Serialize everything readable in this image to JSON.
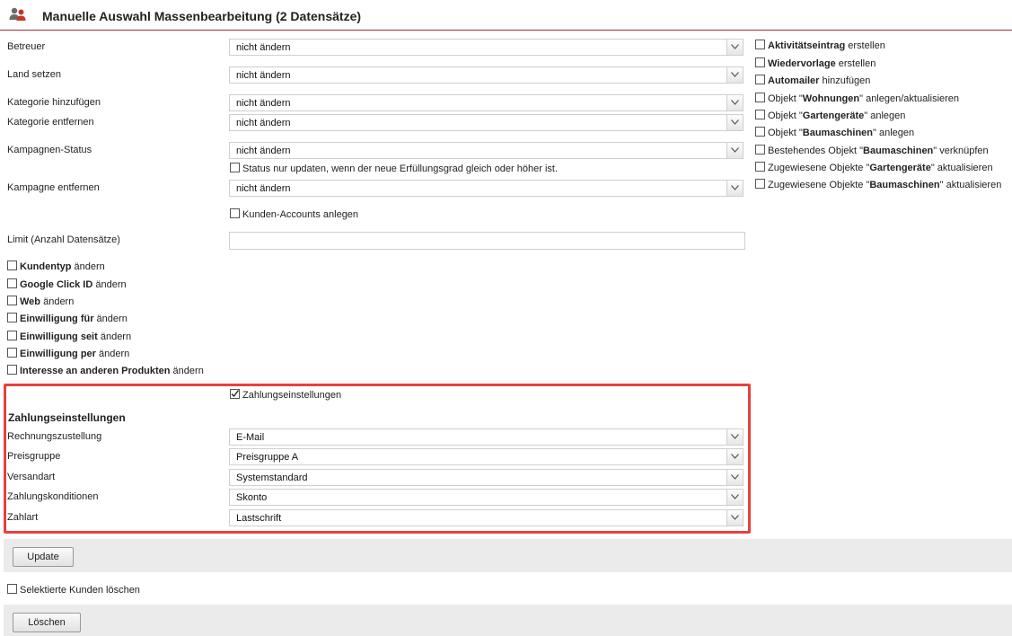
{
  "header": {
    "title": "Manuelle Auswahl Massenbearbeitung (2 Datensätze)"
  },
  "fields": {
    "betreuer": {
      "label": "Betreuer",
      "value": "nicht ändern"
    },
    "land": {
      "label": "Land setzen",
      "value": "nicht ändern"
    },
    "kat_add": {
      "label": "Kategorie hinzufügen",
      "value": "nicht ändern"
    },
    "kat_remove": {
      "label": "Kategorie entfernen",
      "value": "nicht ändern"
    },
    "kampagnen_status": {
      "label": "Kampagnen-Status",
      "value": "nicht ändern"
    },
    "status_update_note": "Status nur updaten, wenn der neue Erfüllungsgrad gleich oder höher ist.",
    "kampagne_remove": {
      "label": "Kampagne entfernen",
      "value": "nicht ändern"
    },
    "kunden_accounts": "Kunden-Accounts anlegen",
    "limit": {
      "label": "Limit (Anzahl Datensätze)",
      "value": ""
    }
  },
  "change_checkboxes": [
    {
      "bold": "Kundentyp",
      "rest": " ändern"
    },
    {
      "bold": "Google Click ID",
      "rest": " ändern"
    },
    {
      "bold": "Web",
      "rest": " ändern"
    },
    {
      "bold": "Einwilligung für",
      "rest": " ändern"
    },
    {
      "bold": "Einwilligung seit",
      "rest": " ändern"
    },
    {
      "bold": "Einwilligung per",
      "rest": " ändern"
    },
    {
      "bold": "Interesse an anderen Produkten",
      "rest": " ändern"
    }
  ],
  "right_checkboxes": [
    {
      "pre": "",
      "bold": "Aktivitätseintrag",
      "post": " erstellen"
    },
    {
      "pre": "",
      "bold": "Wiedervorlage",
      "post": " erstellen"
    },
    {
      "pre": "",
      "bold": "Automailer",
      "post": " hinzufügen"
    },
    {
      "pre": "Objekt \"",
      "bold": "Wohnungen",
      "post": "\" anlegen/aktualisieren"
    },
    {
      "pre": "Objekt \"",
      "bold": "Gartengeräte",
      "post": "\" anlegen"
    },
    {
      "pre": "Objekt \"",
      "bold": "Baumaschinen",
      "post": "\" anlegen"
    },
    {
      "pre": "Bestehendes Objekt \"",
      "bold": "Baumaschinen",
      "post": "\" verknüpfen"
    },
    {
      "pre": "Zugewiesene Objekte \"",
      "bold": "Gartengeräte",
      "post": "\" aktualisieren"
    },
    {
      "pre": "Zugewiesene Objekte \"",
      "bold": "Baumaschinen",
      "post": "\" aktualisieren"
    }
  ],
  "payment": {
    "checkbox_label": "Zahlungseinstellungen",
    "checked": true,
    "section_title": "Zahlungseinstellungen",
    "rechnungszustellung": {
      "label": "Rechnungszustellung",
      "value": "E-Mail"
    },
    "preisgruppe": {
      "label": "Preisgruppe",
      "value": "Preisgruppe A"
    },
    "versandart": {
      "label": "Versandart",
      "value": "Systemstandard"
    },
    "zahlungskonditionen": {
      "label": "Zahlungskonditionen",
      "value": "Skonto"
    },
    "zahlart": {
      "label": "Zahlart",
      "value": "Lastschrift"
    }
  },
  "actions": {
    "update_label": "Update",
    "delete_checkbox_label": "Selektierte Kunden löschen",
    "delete_label": "Löschen"
  },
  "colors": {
    "highlight_border": "#e8403f",
    "header_rule": "#a52a2a",
    "bar_bg": "#ebebeb"
  }
}
